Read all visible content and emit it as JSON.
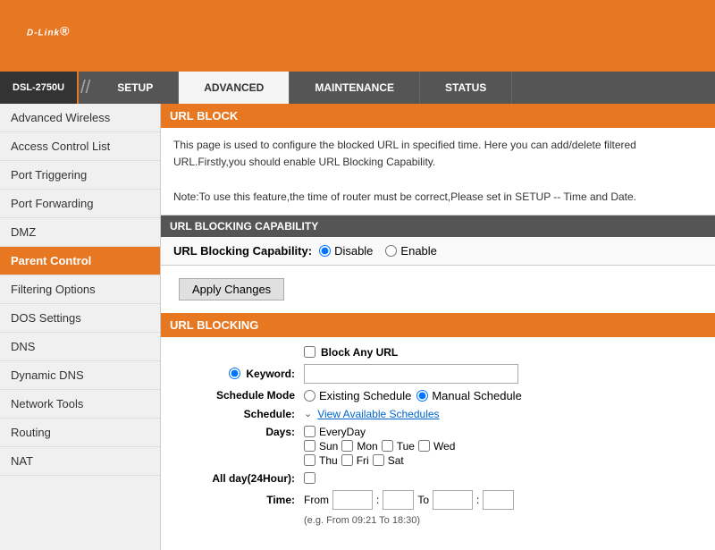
{
  "header": {
    "logo": "D-Link",
    "logo_trademark": "®"
  },
  "device": {
    "model": "DSL-2750U"
  },
  "top_nav": {
    "tabs": [
      {
        "id": "setup",
        "label": "SETUP",
        "active": false
      },
      {
        "id": "advanced",
        "label": "ADVANCED",
        "active": true
      },
      {
        "id": "maintenance",
        "label": "MAINTENANCE",
        "active": false
      },
      {
        "id": "status",
        "label": "STATUS",
        "active": false
      }
    ]
  },
  "sidebar": {
    "items": [
      {
        "id": "advanced-wireless",
        "label": "Advanced Wireless",
        "active": false
      },
      {
        "id": "access-control-list",
        "label": "Access Control List",
        "active": false
      },
      {
        "id": "port-triggering",
        "label": "Port Triggering",
        "active": false
      },
      {
        "id": "port-forwarding",
        "label": "Port Forwarding",
        "active": false
      },
      {
        "id": "dmz",
        "label": "DMZ",
        "active": false
      },
      {
        "id": "parent-control",
        "label": "Parent Control",
        "active": true
      },
      {
        "id": "filtering-options",
        "label": "Filtering Options",
        "active": false
      },
      {
        "id": "dos-settings",
        "label": "DOS Settings",
        "active": false
      },
      {
        "id": "dns",
        "label": "DNS",
        "active": false
      },
      {
        "id": "dynamic-dns",
        "label": "Dynamic DNS",
        "active": false
      },
      {
        "id": "network-tools",
        "label": "Network Tools",
        "active": false
      },
      {
        "id": "routing",
        "label": "Routing",
        "active": false
      },
      {
        "id": "nat",
        "label": "NAT",
        "active": false
      }
    ]
  },
  "content": {
    "url_block_title": "URL BLOCK",
    "info_line1": "This page is used to configure the blocked URL in specified time. Here you can add/delete filtered URL.Firstly,you should enable URL Blocking Capability.",
    "info_line2": "Note:To use this feature,the time of router must be correct,Please set in SETUP -- Time and Date.",
    "capability_header": "URL BLOCKING CAPABILITY",
    "capability_label": "URL Blocking Capability:",
    "capability_disable": "Disable",
    "capability_enable": "Enable",
    "apply_button": "Apply Changes",
    "url_blocking_header": "URL BLOCKING",
    "block_any_url_label": "Block Any URL",
    "keyword_label": "Keyword:",
    "schedule_mode_label": "Schedule Mode",
    "existing_schedule": "Existing Schedule",
    "manual_schedule": "Manual Schedule",
    "schedule_label": "Schedule:",
    "view_schedules": "View Available Schedules",
    "days_label": "Days:",
    "everyday": "EveryDay",
    "day_sun": "Sun",
    "day_mon": "Mon",
    "day_tue": "Tue",
    "day_wed": "Wed",
    "day_thu": "Thu",
    "day_fri": "Fri",
    "day_sat": "Sat",
    "allday_label": "All day(24Hour):",
    "time_label": "Time:",
    "time_from": "From",
    "time_to": "To",
    "time_hint": "(e.g. From 09:21 To 18:30)"
  }
}
